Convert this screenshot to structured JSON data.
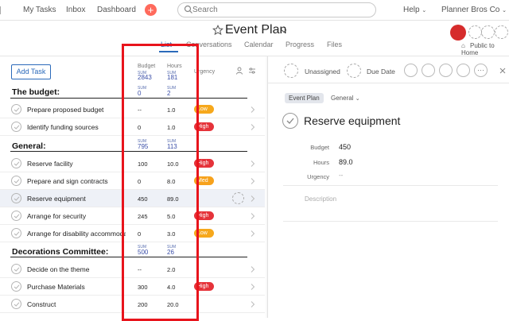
{
  "topbar": {
    "nav": [
      "My Tasks",
      "Inbox",
      "Dashboard"
    ],
    "search_placeholder": "Search",
    "help": "Help",
    "org": "Planner Bros Co",
    "colors": {
      "plus": "#ff6a5c"
    }
  },
  "project": {
    "title": "Event Plan",
    "tabs": [
      "List",
      "Conversations",
      "Calendar",
      "Progress",
      "Files"
    ],
    "public_label": "Public to Home"
  },
  "list": {
    "add_task": "Add Task",
    "columns": {
      "budget": {
        "label": "Budget",
        "sum_label": "SUM",
        "sum": "2843"
      },
      "hours": {
        "label": "Hours",
        "sum_label": "SUM",
        "sum": "181"
      },
      "urgency": {
        "label": "Urgency"
      }
    },
    "sections": [
      {
        "title": "The budget:",
        "sum_label": "SUM",
        "budget_sum": "0",
        "hours_sum": "2",
        "tasks": [
          {
            "name": "Prepare proposed budget",
            "budget": "--",
            "hours": "1.0",
            "urgency": "Low"
          },
          {
            "name": "Identify funding sources",
            "budget": "0",
            "hours": "1.0",
            "urgency": "High"
          }
        ]
      },
      {
        "title": "General:",
        "sum_label": "SUM",
        "budget_sum": "795",
        "hours_sum": "113",
        "tasks": [
          {
            "name": "Reserve facility",
            "budget": "100",
            "hours": "10.0",
            "urgency": "High"
          },
          {
            "name": "Prepare and sign contracts",
            "budget": "0",
            "hours": "8.0",
            "urgency": "Med"
          },
          {
            "name": "Reserve equipment",
            "budget": "450",
            "hours": "89.0",
            "urgency": ""
          },
          {
            "name": "Arrange for security",
            "budget": "245",
            "hours": "5.0",
            "urgency": "High"
          },
          {
            "name": "Arrange for disability accommoda",
            "budget": "0",
            "hours": "3.0",
            "urgency": "Low"
          }
        ]
      },
      {
        "title": "Decorations Committee:",
        "sum_label": "SUM",
        "budget_sum": "500",
        "hours_sum": "26",
        "tasks": [
          {
            "name": "Decide on the theme",
            "budget": "--",
            "hours": "2.0",
            "urgency": ""
          },
          {
            "name": "Purchase Materials",
            "budget": "300",
            "hours": "4.0",
            "urgency": "High"
          },
          {
            "name": "Construct",
            "budget": "200",
            "hours": "20.0",
            "urgency": ""
          }
        ]
      }
    ]
  },
  "detail": {
    "assignee": "Unassigned",
    "due_date": "Due Date",
    "project_tag": "Event Plan",
    "section": "General",
    "title": "Reserve equipment",
    "fields": [
      {
        "label": "Budget",
        "value": "450"
      },
      {
        "label": "Hours",
        "value": "89.0"
      },
      {
        "label": "Urgency",
        "value": "--"
      }
    ],
    "description_placeholder": "Description"
  },
  "overlay": {
    "color": "#e8141c"
  }
}
